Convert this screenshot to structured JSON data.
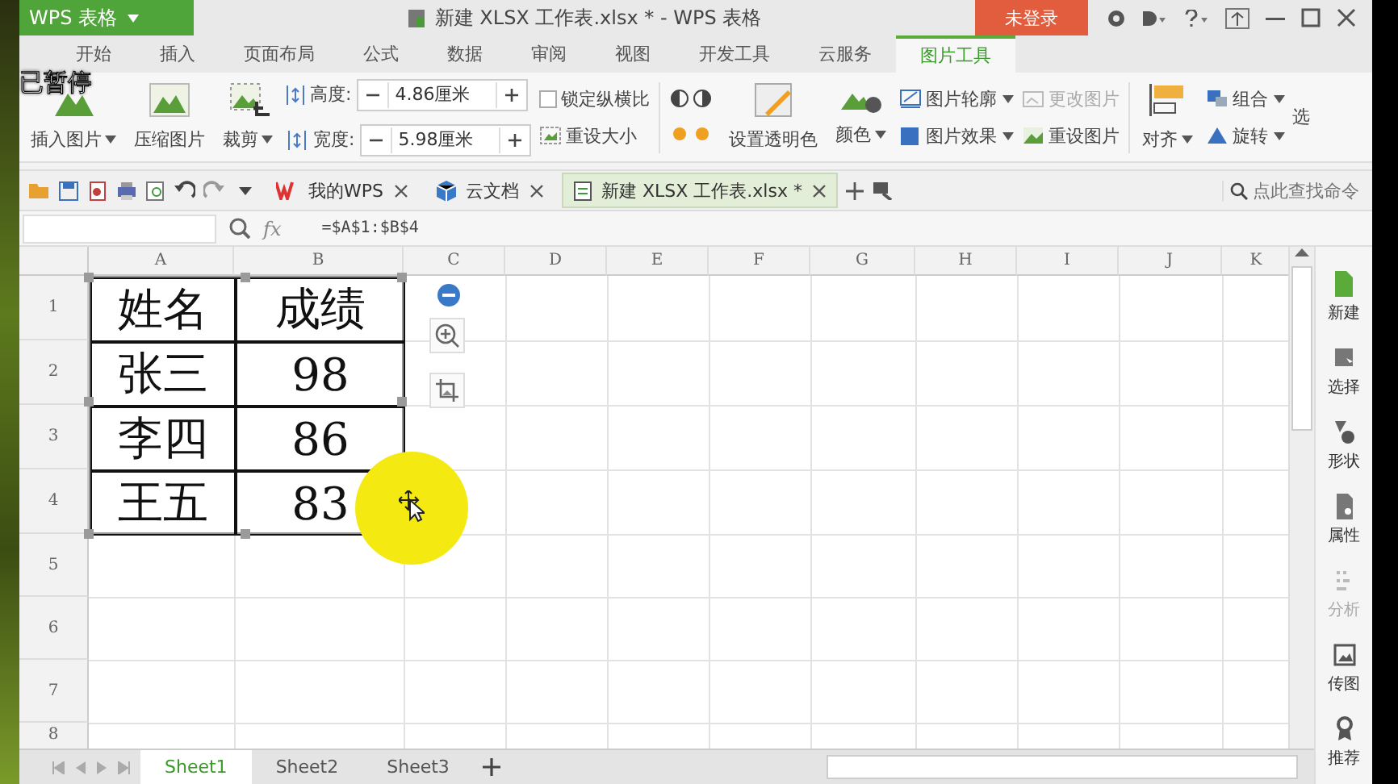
{
  "overlay_label": "已暂停",
  "app_button": {
    "label": "WPS 表格"
  },
  "window": {
    "title": "新建 XLSX 工作表.xlsx * - WPS 表格"
  },
  "login_button": {
    "label": "未登录"
  },
  "menu_tabs": [
    {
      "label": "开始",
      "selected": false
    },
    {
      "label": "插入",
      "selected": false
    },
    {
      "label": "页面布局",
      "selected": false
    },
    {
      "label": "公式",
      "selected": false
    },
    {
      "label": "数据",
      "selected": false
    },
    {
      "label": "审阅",
      "selected": false
    },
    {
      "label": "视图",
      "selected": false
    },
    {
      "label": "开发工具",
      "selected": false
    },
    {
      "label": "云服务",
      "selected": false
    },
    {
      "label": "图片工具",
      "selected": true
    }
  ],
  "ribbon": {
    "insert_picture": "插入图片",
    "compress_picture": "压缩图片",
    "crop": "裁剪",
    "height_label": "高度:",
    "height_value": "4.86厘米",
    "width_label": "宽度:",
    "width_value": "5.98厘米",
    "lock_ratio": {
      "label": "锁定纵横比",
      "checked": false
    },
    "reset_size": "重设大小",
    "set_transparent": "设置透明色",
    "recolor": "颜色",
    "outline": "图片轮廓",
    "effects": "图片效果",
    "change_picture": {
      "label": "更改图片",
      "disabled": true
    },
    "reset_picture": "重设图片",
    "align": "对齐",
    "group": "组合",
    "rotate": "旋转",
    "select": "选"
  },
  "doc_tabs": [
    {
      "label": "我的WPS",
      "selected": false
    },
    {
      "label": "云文档",
      "selected": false
    },
    {
      "label": "新建 XLSX 工作表.xlsx *",
      "selected": true
    }
  ],
  "command_search": {
    "placeholder": "点此查找命令"
  },
  "formula_bar": {
    "fx": "fx",
    "formula": "=$A$1:$B$4"
  },
  "columns": [
    "A",
    "B",
    "C",
    "D",
    "E",
    "F",
    "G",
    "H",
    "I",
    "J",
    "K"
  ],
  "rows": [
    "1",
    "2",
    "3",
    "4",
    "5",
    "6",
    "7",
    "8"
  ],
  "picture_table": {
    "rows": [
      [
        "姓名",
        "成绩"
      ],
      [
        "张三",
        "98"
      ],
      [
        "李四",
        "86"
      ],
      [
        "王五",
        "83"
      ]
    ]
  },
  "side_panel": [
    {
      "label": "新建",
      "disabled": false
    },
    {
      "label": "选择",
      "disabled": false
    },
    {
      "label": "形状",
      "disabled": false
    },
    {
      "label": "属性",
      "disabled": false
    },
    {
      "label": "分析",
      "disabled": true
    },
    {
      "label": "传图",
      "disabled": false
    },
    {
      "label": "推荐",
      "disabled": false
    }
  ],
  "sheet_tabs": [
    {
      "label": "Sheet1",
      "selected": true
    },
    {
      "label": "Sheet2",
      "selected": false
    },
    {
      "label": "Sheet3",
      "selected": false
    }
  ]
}
